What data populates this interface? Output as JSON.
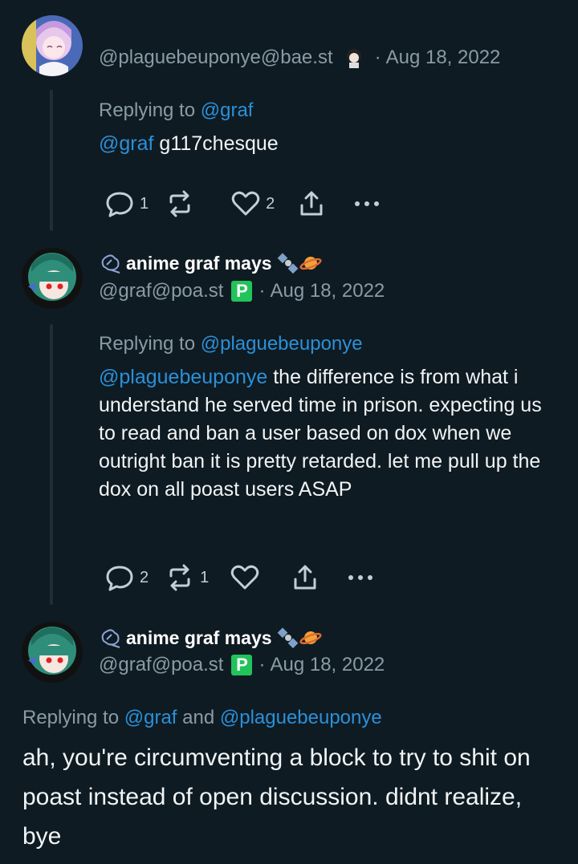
{
  "posts": [
    {
      "handle": "@plaguebeuponye@bae.st",
      "date": "Aug 18, 2022",
      "replying_prefix": "Replying to",
      "replying_mention": "@graf",
      "content_mention": "@graf",
      "content_text": " g117chesque",
      "counts": {
        "reply": "1",
        "boost": "",
        "like": "2"
      }
    },
    {
      "display_name": "anime graf mays",
      "handle": "@graf@poa.st",
      "date": "Aug 18, 2022",
      "replying_prefix": "Replying to",
      "replying_mention": "@plaguebeuponye",
      "content_mention": "@plaguebeuponye",
      "content_text": " the difference is from what i understand he served time in prison. expecting us to read and ban a user based on dox when we outright ban it is pretty retarded. let me pull up the dox on all poast users ASAP",
      "counts": {
        "reply": "2",
        "boost": "1",
        "like": ""
      }
    },
    {
      "display_name": "anime graf mays",
      "handle": "@graf@poa.st",
      "date": "Aug 18, 2022",
      "replying_prefix": "Replying to",
      "replying_mention_1": "@graf",
      "replying_and": "and",
      "replying_mention_2": "@plaguebeuponye",
      "content_text": "ah, you're circumventing a block to try to shit on poast instead of open discussion. didnt realize, bye"
    }
  ],
  "separator": "·",
  "badge_letter": "P",
  "icons": {
    "reply": "reply-icon",
    "boost": "boost-icon",
    "like": "like-icon",
    "share": "share-icon",
    "more": "more-icon"
  },
  "colors": {
    "background": "#0f1b22",
    "mention": "#2b90d9",
    "muted": "#8a9ba6",
    "badge": "#22c35a"
  }
}
